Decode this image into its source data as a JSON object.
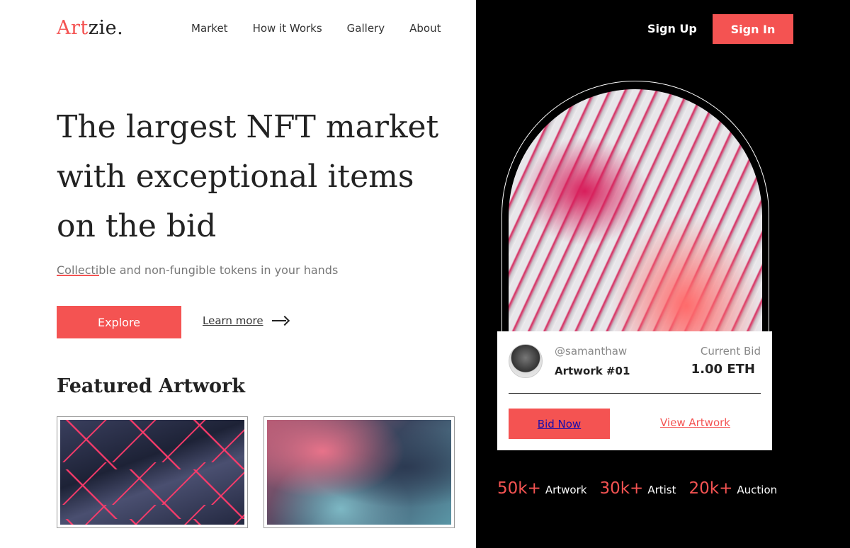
{
  "brand": {
    "name_accent": "Art",
    "name_rest": "zie."
  },
  "nav": {
    "items": [
      "Market",
      "How it Works",
      "Gallery",
      "About"
    ]
  },
  "auth": {
    "signup_label": "Sign Up",
    "signin_label": "Sign In"
  },
  "hero": {
    "title_line1": "The largest NFT market",
    "title_line2": "with exceptional items",
    "title_line3": "on the bid",
    "subtitle": "Collectible and non-fungible tokens in your hands",
    "explore_label": "Explore",
    "learn_more_label": "Learn more"
  },
  "featured": {
    "title": "Featured Artwork"
  },
  "card": {
    "username": "@samanthaw",
    "artwork_name": "Artwork #01",
    "bid_label": "Current Bid",
    "bid_value": "1.00 ETH",
    "bid_button_label": "Bid Now",
    "view_label": "View Artwork"
  },
  "stats": [
    {
      "value": "50k+",
      "label": "Artwork"
    },
    {
      "value": "30k+",
      "label": "Artist"
    },
    {
      "value": "20k+",
      "label": "Auction"
    }
  ],
  "colors": {
    "accent": "#f45352",
    "dark": "#000000",
    "text": "#222222"
  },
  "icons": {
    "learn_more": "arrow-right-icon"
  }
}
